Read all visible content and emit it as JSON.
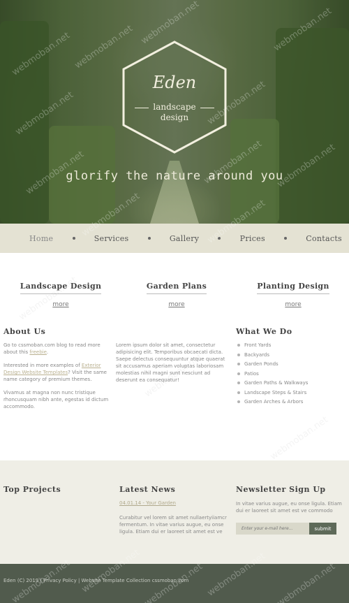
{
  "hero": {
    "logo_title": "Eden",
    "logo_sub_1": "landscape",
    "logo_sub_2": "design",
    "tagline": "glorify the nature around you"
  },
  "nav": {
    "items": [
      "Home",
      "Services",
      "Gallery",
      "Prices",
      "Contacts"
    ]
  },
  "services": [
    {
      "title": "Landscape Design",
      "more": "more"
    },
    {
      "title": "Garden Plans",
      "more": "more"
    },
    {
      "title": "Planting Design",
      "more": "more"
    }
  ],
  "about": {
    "heading": "About Us",
    "p1_a": "Go to cssmoban.com blog to read more about this ",
    "p1_link": "freebie",
    "p1_b": ".",
    "p2_a": "Interested in more examples of ",
    "p2_link": "Exterior Design Website Templates",
    "p2_b": "? Visit the same name category of premium themes.",
    "p3": "Vivamus at magna non nunc tristique rhoncusquam nibh ante, egestas id dictum accommodo.",
    "p4": "Lorem ipsum dolor sit amet, consectetur adipisicing elit. Temporibus obcaecati dicta. Saepe delectus consequuntur atque quaerat sit accusamus aperiam voluptas laboriosam molestias nihil magni sunt nesciunt ad deserunt ea consequatur!"
  },
  "what_we_do": {
    "heading": "What We Do",
    "items": [
      "Front Yards",
      "Backyards",
      "Garden Ponds",
      "Patios",
      "Garden Paths & Walkways",
      "Landscape Steps & Stairs",
      "Garden Arches & Arbors"
    ]
  },
  "bottom": {
    "projects_heading": "Top Projects",
    "news_heading": "Latest News",
    "news_date": "04.01.14 - Your Garden",
    "news_text": "Curabitur vel lorem sit amet nullaertyiiamcr fermentum. In vitae varius augue, eu onse ligula. Etiam dui er laoreet sit amet est ve",
    "newsletter_heading": "Newsletter Sign Up",
    "newsletter_text": "In vitae varius augue, eu onse ligula. Etiam dui er laoreet sit amet est ve commodo",
    "input_placeholder": "Enter your e-mail here...",
    "submit_label": "submit"
  },
  "footer": {
    "text": "Eden (C) 2019  |  Privacy Policy  |  Website Template Collection cssmoban.com"
  },
  "watermark": "webmoban.net",
  "colors": {
    "nav_bg": "#e4e2d3",
    "panel_bg": "#efeee6",
    "footer_bg": "#515b4d",
    "accent_link": "#b9b08f",
    "button_bg": "#5e6a59"
  }
}
